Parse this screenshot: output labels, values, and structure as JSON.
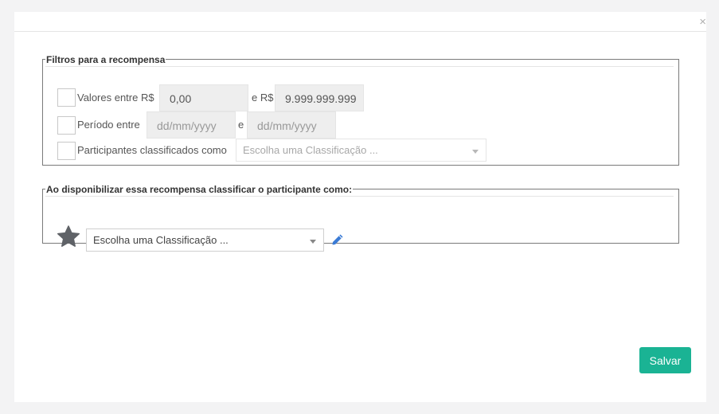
{
  "modal": {
    "close_symbol": "×"
  },
  "filters": {
    "legend": "Filtros para a recompensa",
    "values_label": "Valores entre R$",
    "values_min": "0,00",
    "values_sep": "e R$",
    "values_max": "9.999.999.999",
    "period_label": "Período entre",
    "period_start_placeholder": "dd/mm/yyyy",
    "period_sep": "e",
    "period_end_placeholder": "dd/mm/yyyy",
    "participants_label": "Participantes classificados como",
    "participants_select": "Escolha uma Classificação ..."
  },
  "classify": {
    "legend": "Ao disponibilizar essa recompensa classificar o participante como:",
    "select": "Escolha uma Classificação ...",
    "star_icon": "star-icon",
    "edit_icon": "pencil-icon"
  },
  "actions": {
    "save_label": "Salvar"
  },
  "colors": {
    "save_button": "#1ab394",
    "edit_icon": "#3a7bd5",
    "star_icon": "#5f6267"
  }
}
